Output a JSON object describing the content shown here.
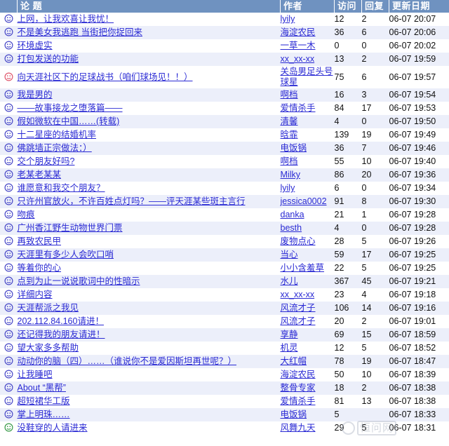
{
  "header": {
    "icon_col": "",
    "title": "论  题",
    "author": "作者",
    "views": "访问",
    "replies": "回复",
    "date": "更新日期"
  },
  "colors": {
    "header_bg": "#6f92c0",
    "header_text": "#ffffff",
    "link": "#2a2ad4",
    "row_alt_bg": "#eceffa",
    "row_bg": "#ffffff",
    "icon_normal": "#4a4ac8",
    "icon_hot": "#e05a6e",
    "icon_green": "#3a9b4a"
  },
  "watermark": {
    "text": "恒问网"
  },
  "rows": [
    {
      "icon": "smiley-blue-icon",
      "title": "上网，让我欢喜让我忧！",
      "author": "lyily",
      "views": "12",
      "replies": "2",
      "date": "06-07 20:07"
    },
    {
      "icon": "smiley-blue-icon",
      "title": "不是美女我逃跑 当街把你捉回来",
      "author": "海淀农民",
      "views": "36",
      "replies": "6",
      "date": "06-07 20:06"
    },
    {
      "icon": "smiley-blue-icon",
      "title": "环境虚实",
      "author": "一草一木",
      "views": "0",
      "replies": "0",
      "date": "06-07 20:02"
    },
    {
      "icon": "smiley-blue-icon",
      "title": "打包发送的功能",
      "author": "xx_xx-xx",
      "views": "13",
      "replies": "2",
      "date": "06-07 19:59"
    },
    {
      "icon": "smiley-red-icon",
      "title": "向天涯社区下的足球战书（咱们球场见！！）",
      "author": "关岛男足头号球星",
      "views": "75",
      "replies": "6",
      "date": "06-07 19:57"
    },
    {
      "icon": "smiley-blue-icon",
      "title": "我是男的",
      "author": "啊档",
      "views": "16",
      "replies": "3",
      "date": "06-07 19:54"
    },
    {
      "icon": "smiley-blue-icon",
      "title": "——故事接龙之堕落篇——",
      "author": "爱情杀手",
      "views": "84",
      "replies": "17",
      "date": "06-07 19:53"
    },
    {
      "icon": "smiley-blue-icon",
      "title": "假如微软在中国……(转载)",
      "author": "清馨",
      "views": "4",
      "replies": "0",
      "date": "06-07 19:50"
    },
    {
      "icon": "smiley-blue-icon",
      "title": "十二星座的结婚机率",
      "author": "晗霏",
      "views": "139",
      "replies": "19",
      "date": "06-07 19:49"
    },
    {
      "icon": "smiley-blue-icon",
      "title": "佛跳墙正宗做法：）",
      "author": "电饭锅",
      "views": "36",
      "replies": "7",
      "date": "06-07 19:46"
    },
    {
      "icon": "smiley-blue-icon",
      "title": "交个朋友好吗?",
      "author": "啊档",
      "views": "55",
      "replies": "10",
      "date": "06-07 19:40"
    },
    {
      "icon": "smiley-blue-icon",
      "title": "老某老某某",
      "author": "Milky",
      "views": "86",
      "replies": "20",
      "date": "06-07 19:36"
    },
    {
      "icon": "smiley-blue-icon",
      "title": "谁愿意和我交个朋友？",
      "author": "lyily",
      "views": "6",
      "replies": "0",
      "date": "06-07 19:34"
    },
    {
      "icon": "smiley-blue-icon",
      "title": "只许州官放火，不许百姓点灯吗？——评天涯某些斑主言行",
      "author": "jessica0002",
      "views": "91",
      "replies": "8",
      "date": "06-07 19:30"
    },
    {
      "icon": "smiley-blue-icon",
      "title": "吻痕",
      "author": "danka",
      "views": "21",
      "replies": "1",
      "date": "06-07 19:28"
    },
    {
      "icon": "smiley-blue-icon",
      "title": "广州香江野生动物世界门票",
      "author": "besth",
      "views": "4",
      "replies": "0",
      "date": "06-07 19:28"
    },
    {
      "icon": "smiley-blue-icon",
      "title": "再致农民甲",
      "author": "废物点心",
      "views": "28",
      "replies": "5",
      "date": "06-07 19:26"
    },
    {
      "icon": "smiley-blue-icon",
      "title": "天涯里有多少人会吹口哨",
      "author": "当心",
      "views": "59",
      "replies": "17",
      "date": "06-07 19:25"
    },
    {
      "icon": "smiley-blue-icon",
      "title": "等着你的心",
      "author": "小小含羞草",
      "views": "22",
      "replies": "5",
      "date": "06-07 19:25"
    },
    {
      "icon": "smiley-blue-icon",
      "title": "点到为止一说说歌词中的性暗示",
      "author": "水儿",
      "views": "367",
      "replies": "45",
      "date": "06-07 19:21"
    },
    {
      "icon": "smiley-blue-icon",
      "title": "详细内容",
      "author": "xx_xx-xx",
      "views": "23",
      "replies": "4",
      "date": "06-07 19:18"
    },
    {
      "icon": "smiley-blue-icon",
      "title": "天涯帮派之我见",
      "author": "风流才子",
      "views": "106",
      "replies": "14",
      "date": "06-07 19:16"
    },
    {
      "icon": "smiley-blue-icon",
      "title": "202.112.84.160请进！",
      "author": "风流才子",
      "views": "20",
      "replies": "2",
      "date": "06-07 19:01"
    },
    {
      "icon": "smiley-blue-icon",
      "title": "还记得我的朋友请进！",
      "author": "享静",
      "views": "69",
      "replies": "15",
      "date": "06-07 18:59"
    },
    {
      "icon": "smiley-blue-icon",
      "title": "望大家多多帮助",
      "author": "机灵",
      "views": "12",
      "replies": "5",
      "date": "06-07 18:52"
    },
    {
      "icon": "smiley-blue-icon",
      "title": "动动你的脑（四）……（谁说你不是爱因斯坦再世呢？）",
      "author": "大红帽",
      "views": "78",
      "replies": "19",
      "date": "06-07 18:47"
    },
    {
      "icon": "smiley-blue-icon",
      "title": "让我睡吧",
      "author": "海淀农民",
      "views": "50",
      "replies": "10",
      "date": "06-07 18:39"
    },
    {
      "icon": "smiley-blue-icon",
      "title": "About “黑帮”",
      "author": "整骨专家",
      "views": "18",
      "replies": "2",
      "date": "06-07 18:38"
    },
    {
      "icon": "smiley-blue-icon",
      "title": "超短裙华工版",
      "author": "爱情杀手",
      "views": "81",
      "replies": "13",
      "date": "06-07 18:38"
    },
    {
      "icon": "smiley-blue-icon",
      "title": "掌上明珠……",
      "author": "电饭锅",
      "views": "5",
      "replies": "",
      "date": "06-07 18:33"
    },
    {
      "icon": "smiley-green-icon",
      "title": "没鞋穿的人请进来",
      "author": "风舞九天",
      "views": "29",
      "replies": "5",
      "date": "06-07 18:31"
    }
  ]
}
